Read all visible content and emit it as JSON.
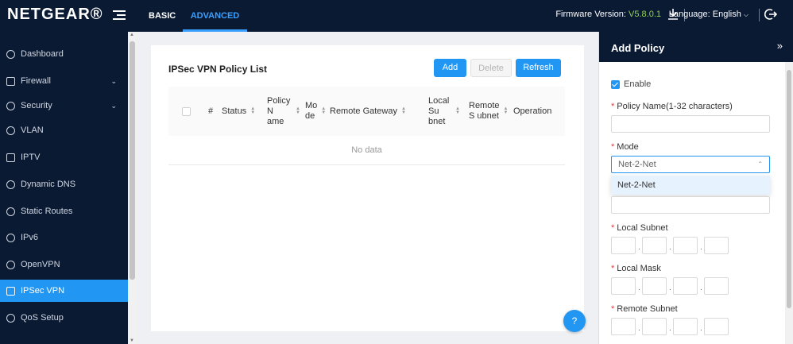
{
  "header": {
    "logo": "NETGEAR®",
    "tabs": [
      {
        "label": "BASIC"
      },
      {
        "label": "ADVANCED"
      }
    ],
    "firmware_label": "Firmware Version:",
    "firmware_version": "V5.8.0.1",
    "language_label": "Language: English"
  },
  "sidebar": {
    "items": [
      {
        "label": "Dashboard"
      },
      {
        "label": "Firewall"
      },
      {
        "label": "Security"
      },
      {
        "label": "VLAN"
      },
      {
        "label": "IPTV"
      },
      {
        "label": "Dynamic DNS"
      },
      {
        "label": "Static Routes"
      },
      {
        "label": "IPv6"
      },
      {
        "label": "OpenVPN"
      },
      {
        "label": "IPSec VPN"
      },
      {
        "label": "QoS Setup"
      }
    ]
  },
  "main": {
    "title": "IPSec VPN Policy List",
    "buttons": {
      "add": "Add",
      "delete": "Delete",
      "refresh": "Refresh"
    },
    "columns": [
      {
        "label": "#"
      },
      {
        "label": "Status"
      },
      {
        "label": "Policy N ame"
      },
      {
        "label": "Mo de"
      },
      {
        "label": "Remote Gateway"
      },
      {
        "label": "Local Su bnet"
      },
      {
        "label": "Remote S ubnet"
      },
      {
        "label": "Operation"
      }
    ],
    "empty_text": "No data",
    "help": "?"
  },
  "drawer": {
    "title": "Add Policy",
    "enable_label": "Enable",
    "policy_name_label": "Policy Name(1-32 characters)",
    "mode_label": "Mode",
    "mode_value": "Net-2-Net",
    "mode_options": [
      "Net-2-Net"
    ],
    "local_subnet_label": "Local Subnet",
    "local_mask_label": "Local Mask",
    "remote_subnet_label": "Remote Subnet"
  },
  "colors": {
    "nav_bg": "#0b1a33",
    "accent": "#2196f3",
    "firmware_green": "#8fd14f"
  }
}
